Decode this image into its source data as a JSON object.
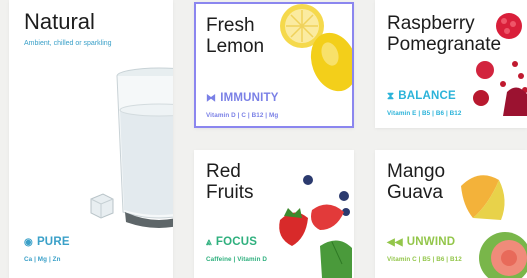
{
  "cards": [
    {
      "title": "Natural",
      "subtitle": "Ambient, chilled or sparkling",
      "feature": "PURE",
      "nutrients": "Ca | Mg | Zn",
      "color": "#3aa0c8"
    },
    {
      "title": "Fresh\nLemon",
      "feature": "IMMUNITY",
      "nutrients": "Vitamin D | C | B12 | Mg",
      "color": "#7a80e6"
    },
    {
      "title": "Raspberry\nPomegranate",
      "feature": "BALANCE",
      "nutrients": "Vitamin E | B5 | B6 | B12",
      "color": "#2bb3d9"
    },
    {
      "title": "Red\nFruits",
      "feature": "FOCUS",
      "nutrients": "Caffeine | Vitamin D",
      "color": "#2fb07e"
    },
    {
      "title": "Mango\nGuava",
      "feature": "UNWIND",
      "nutrients": "Vitamin C | B5 | B6 | B12",
      "color": "#93c64a"
    }
  ],
  "icons": {
    "pure": "circle-icon",
    "immunity": "shield-icon",
    "balance": "hourglass-icon",
    "focus": "chevron-up-icon",
    "unwind": "rewind-icon"
  }
}
